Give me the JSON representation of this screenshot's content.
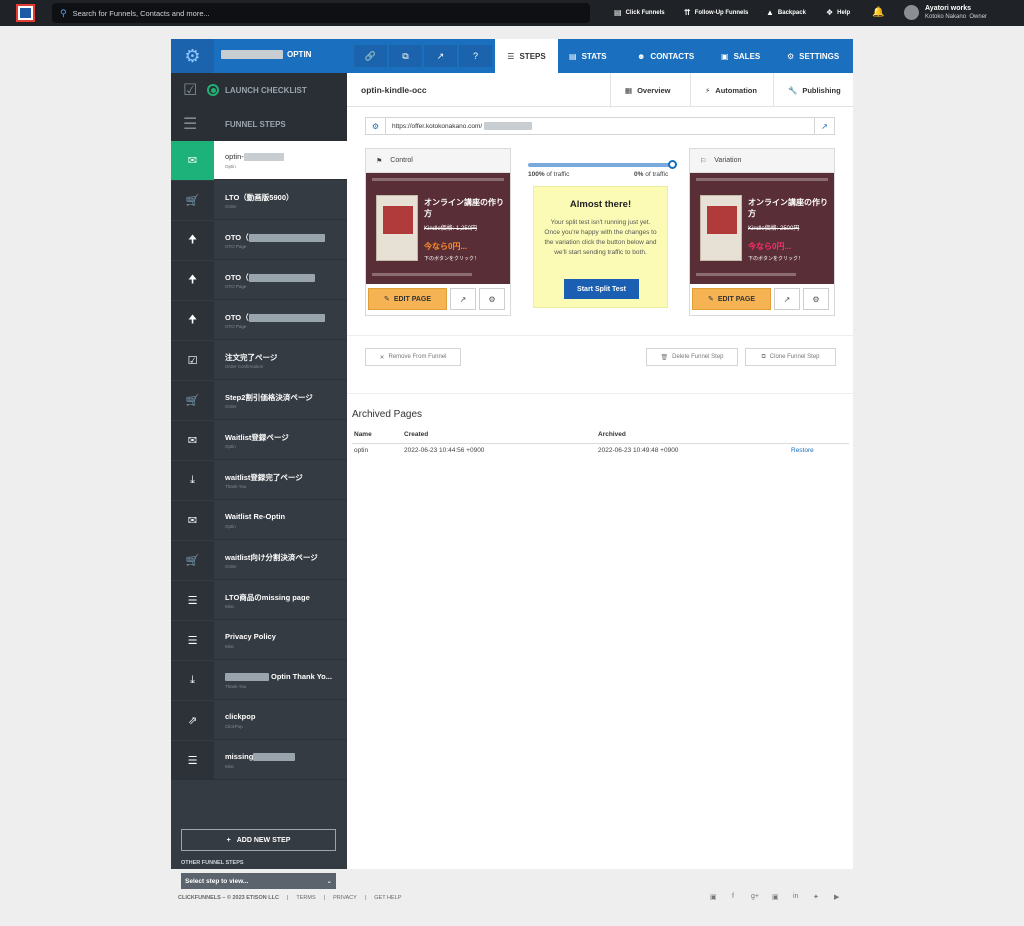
{
  "topbar": {
    "search_placeholder": "Search for Funnels, Contacts and more...",
    "links": [
      {
        "label": "Click Funnels",
        "icon": "clickfunnels-icon"
      },
      {
        "label": "Follow-Up Funnels",
        "icon": "followup-icon"
      },
      {
        "label": "Backpack",
        "icon": "backpack-icon"
      },
      {
        "label": "Help",
        "icon": "help-icon"
      }
    ],
    "user_name": "Ayatori works",
    "user_sub": "Kotoko Nakano",
    "user_role": "Owner"
  },
  "nav": {
    "funnel_suffix": "OPTIN",
    "tabs": [
      {
        "label": "STEPS"
      },
      {
        "label": "STATS"
      },
      {
        "label": "CONTACTS"
      },
      {
        "label": "SALES"
      },
      {
        "label": "SETTINGS"
      }
    ]
  },
  "sidebar": {
    "launch_checklist": "LAUNCH CHECKLIST",
    "funnel_steps": "FUNNEL STEPS",
    "steps": [
      {
        "title": "optin-",
        "type": "Optin",
        "icon": "envelope-icon"
      },
      {
        "title": "LTO（動画版5900）",
        "type": "Order",
        "icon": "cart-icon"
      },
      {
        "title": "OTO（",
        "type": "OTO Page",
        "icon": "arrow-up-icon"
      },
      {
        "title": "OTO（",
        "type": "OTO Page",
        "icon": "arrow-up-icon"
      },
      {
        "title": "OTO（",
        "type": "OTO Page",
        "icon": "arrow-up-icon"
      },
      {
        "title": "注文完了ページ",
        "type": "Order Confirmation",
        "icon": "check-icon"
      },
      {
        "title": "Step2割引価格決済ページ",
        "type": "Order",
        "icon": "cart-icon"
      },
      {
        "title": "Waitlist登録ページ",
        "type": "Optin",
        "icon": "envelope-icon"
      },
      {
        "title": "waitlist登録完了ページ",
        "type": "Thank You",
        "icon": "download-icon"
      },
      {
        "title": "Waitlist Re-Optin",
        "type": "Optin",
        "icon": "envelope-icon"
      },
      {
        "title": "waitlist向け分割決済ページ",
        "type": "Order",
        "icon": "cart-icon"
      },
      {
        "title": "LTO商品のmissing page",
        "type": "Misc",
        "icon": "bars-icon"
      },
      {
        "title": "Privacy Policy",
        "type": "Misc",
        "icon": "bars-icon"
      },
      {
        "title": "Optin Thank Yo...",
        "type": "Thank You",
        "icon": "download-icon"
      },
      {
        "title": "clickpop",
        "type": "ClickPop",
        "icon": "popup-icon"
      },
      {
        "title": "missing",
        "type": "Misc",
        "icon": "bars-icon"
      }
    ],
    "add_new_step": "ADD NEW STEP",
    "other_steps_label": "OTHER FUNNEL STEPS",
    "select_placeholder": "Select step to view..."
  },
  "content": {
    "step_name": "optin-kindle-occ",
    "subtabs": [
      {
        "label": "Overview"
      },
      {
        "label": "Automation"
      },
      {
        "label": "Publishing"
      }
    ],
    "url": "https://offer.kotokonakano.com/",
    "control_label": "Control",
    "variation_label": "Variation",
    "traffic_left_pct": "100%",
    "traffic_right_pct": "0%",
    "traffic_suffix": " of traffic",
    "traffic_fill": 1.0,
    "almost_title": "Almost there!",
    "almost_text": "Your split test isn't running just yet. Once you're happy with the changes to the variation click the button below and we'll start sending traffic to both.",
    "split_btn": "Start Split Test",
    "edit_page": "EDIT PAGE",
    "remove_btn": "Remove From Funnel",
    "delete_btn": "Delete Funnel Step",
    "clone_btn": "Clone Funnel Step",
    "control_thumb": {
      "title": "オンライン講座の作り方",
      "price": "Kindle価格: 1,250円",
      "now": "今なら0円...",
      "cta": "下のボタンをクリック！"
    },
    "variation_thumb": {
      "title": "オンライン講座の作り方",
      "price": "Kindle価格: 2500円",
      "now": "今なら0円...",
      "cta": "下のボタンをクリック！"
    },
    "archived": {
      "title": "Archived Pages",
      "headers": [
        "Name",
        "Created",
        "Archived"
      ],
      "rows": [
        {
          "name": "optin",
          "created": "2022-06-23 10:44:56 +0900",
          "archived": "2022-06-23 10:49:48 +0900",
          "action": "Restore"
        }
      ]
    }
  },
  "footer": {
    "brand": "CLICKFUNNELS",
    "copy": "© 2023 ETISON LLC",
    "links": [
      "TERMS",
      "PRIVACY",
      "GET HELP"
    ],
    "social": [
      "instagram-icon",
      "facebook-icon",
      "googleplus-icon",
      "instagram-icon",
      "linkedin-icon",
      "twitter-icon",
      "youtube-icon"
    ]
  },
  "colors": {
    "nav_blue": "#1a6fbe",
    "sidebar": "#353b42",
    "active_green": "#1cb27a",
    "edit_orange": "#f5b354",
    "split_blue": "#1b5fb3",
    "almost_yellow": "#fbfbb5"
  }
}
